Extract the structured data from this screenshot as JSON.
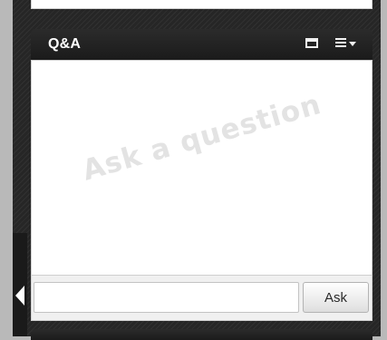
{
  "qa_panel": {
    "title": "Q&A",
    "watermark": "Ask a question",
    "input": {
      "value": "",
      "placeholder": ""
    },
    "ask_label": "Ask",
    "header_icons": [
      "popout-icon",
      "menu-list-icon",
      "dropdown-caret-icon"
    ]
  },
  "sidebar": {
    "toggle_icon": "collapse-left-arrow-icon"
  },
  "colors": {
    "header_bg": "#1f1f1f",
    "panel_bg": "#ffffff",
    "watermark_text": "#e3e3e3",
    "page_bg": "#b9b9b9"
  }
}
